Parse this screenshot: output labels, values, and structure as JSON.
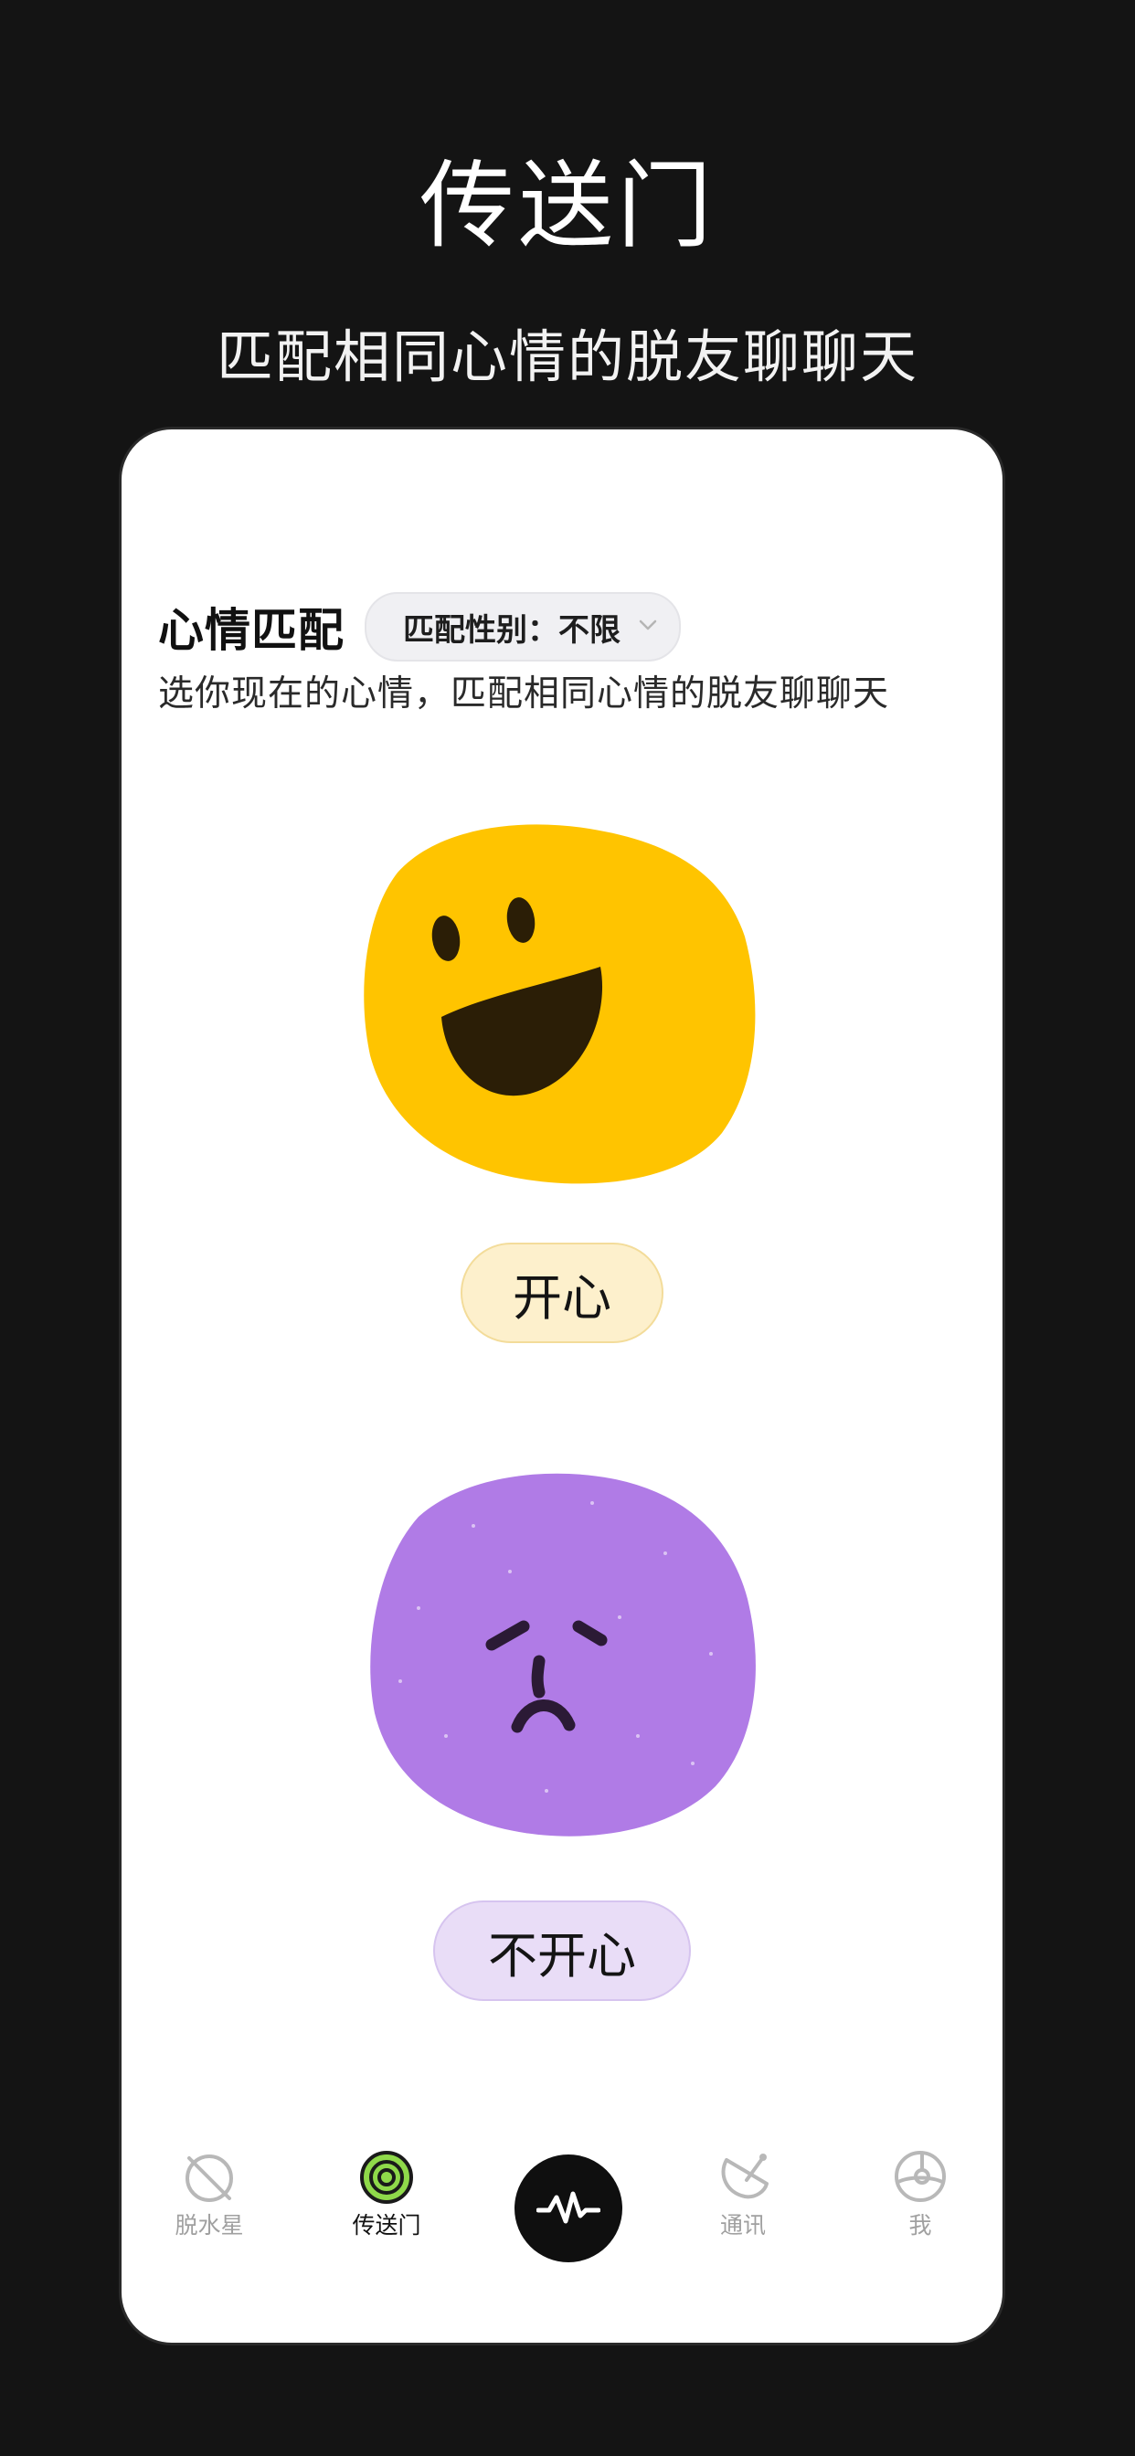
{
  "promo": {
    "title": "传送门",
    "subtitle": "匹配相同心情的脱友聊聊天"
  },
  "header": {
    "title": "心情匹配",
    "gender_filter_label": "匹配性别：不限",
    "description": "选你现在的心情，匹配相同心情的脱友聊聊天"
  },
  "moods": [
    {
      "label": "开心",
      "color": "#ffc400",
      "icon": "happy-face-icon"
    },
    {
      "label": "不开心",
      "color": "#b07be6",
      "icon": "sad-face-icon"
    }
  ],
  "tabbar": {
    "items": [
      {
        "label": "脱水星",
        "icon": "planet-icon",
        "active": false
      },
      {
        "label": "传送门",
        "icon": "portal-swirl-icon",
        "active": true
      },
      {
        "label": "",
        "icon": "pulse-wave-icon",
        "active": false
      },
      {
        "label": "通讯",
        "icon": "satellite-dish-icon",
        "active": false
      },
      {
        "label": "我",
        "icon": "astronaut-helmet-icon",
        "active": false
      }
    ]
  },
  "colors": {
    "background": "#141414",
    "card": "#ffffff",
    "happy": "#ffc400",
    "sad": "#b07be6",
    "portal_green": "#8fd94a"
  }
}
